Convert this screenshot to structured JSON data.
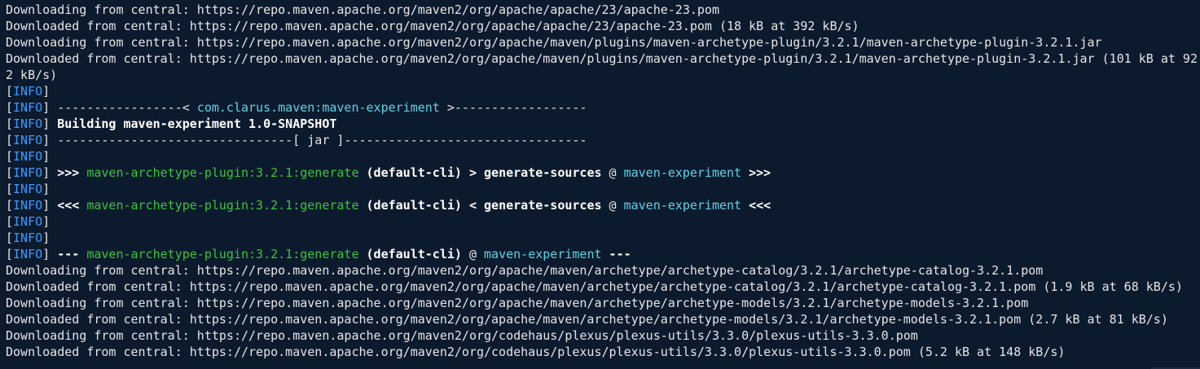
{
  "terminal": {
    "lines": [
      [
        {
          "t": "Downloading from central: https://repo.maven.apache.org/maven2/org/apache/apache/23/apache-23.pom",
          "c": "plain"
        }
      ],
      [
        {
          "t": "Downloaded from central: https://repo.maven.apache.org/maven2/org/apache/apache/23/apache-23.pom (18 kB at 392 kB/s)",
          "c": "plain"
        }
      ],
      [
        {
          "t": "Downloading from central: https://repo.maven.apache.org/maven2/org/apache/maven/plugins/maven-archetype-plugin/3.2.1/maven-archetype-plugin-3.2.1.jar",
          "c": "plain"
        }
      ],
      [
        {
          "t": "Downloaded from central: https://repo.maven.apache.org/maven2/org/apache/maven/plugins/maven-archetype-plugin/3.2.1/maven-archetype-plugin-3.2.1.jar (101 kB at 92",
          "c": "plain"
        }
      ],
      [
        {
          "t": "2 kB/s)",
          "c": "plain"
        }
      ],
      [
        {
          "t": "[",
          "c": "bracket"
        },
        {
          "t": "INFO",
          "c": "info"
        },
        {
          "t": "]",
          "c": "bracket"
        }
      ],
      [
        {
          "t": "[",
          "c": "bracket"
        },
        {
          "t": "INFO",
          "c": "info"
        },
        {
          "t": "] -----------------< ",
          "c": "bracket"
        },
        {
          "t": "com.clarus.maven:maven-experiment",
          "c": "cyan"
        },
        {
          "t": " >------------------",
          "c": "bracket"
        }
      ],
      [
        {
          "t": "[",
          "c": "bracket"
        },
        {
          "t": "INFO",
          "c": "info"
        },
        {
          "t": "] ",
          "c": "bracket"
        },
        {
          "t": "Building maven-experiment 1.0-SNAPSHOT",
          "c": "bold"
        }
      ],
      [
        {
          "t": "[",
          "c": "bracket"
        },
        {
          "t": "INFO",
          "c": "info"
        },
        {
          "t": "] --------------------------------[ jar ]---------------------------------",
          "c": "bracket"
        }
      ],
      [
        {
          "t": "[",
          "c": "bracket"
        },
        {
          "t": "INFO",
          "c": "info"
        },
        {
          "t": "]",
          "c": "bracket"
        }
      ],
      [
        {
          "t": "[",
          "c": "bracket"
        },
        {
          "t": "INFO",
          "c": "info"
        },
        {
          "t": "] ",
          "c": "bracket"
        },
        {
          "t": ">>> ",
          "c": "bold"
        },
        {
          "t": "maven-archetype-plugin:3.2.1:generate",
          "c": "green"
        },
        {
          "t": " (default-cli) > generate-sources",
          "c": "bold"
        },
        {
          "t": " @ ",
          "c": "plain"
        },
        {
          "t": "maven-experiment",
          "c": "cyan"
        },
        {
          "t": " >>>",
          "c": "bold"
        }
      ],
      [
        {
          "t": "[",
          "c": "bracket"
        },
        {
          "t": "INFO",
          "c": "info"
        },
        {
          "t": "]",
          "c": "bracket"
        }
      ],
      [
        {
          "t": "[",
          "c": "bracket"
        },
        {
          "t": "INFO",
          "c": "info"
        },
        {
          "t": "] ",
          "c": "bracket"
        },
        {
          "t": "<<< ",
          "c": "bold"
        },
        {
          "t": "maven-archetype-plugin:3.2.1:generate",
          "c": "green"
        },
        {
          "t": " (default-cli) < generate-sources",
          "c": "bold"
        },
        {
          "t": " @ ",
          "c": "plain"
        },
        {
          "t": "maven-experiment",
          "c": "cyan"
        },
        {
          "t": " <<<",
          "c": "bold"
        }
      ],
      [
        {
          "t": "[",
          "c": "bracket"
        },
        {
          "t": "INFO",
          "c": "info"
        },
        {
          "t": "]",
          "c": "bracket"
        }
      ],
      [
        {
          "t": "[",
          "c": "bracket"
        },
        {
          "t": "INFO",
          "c": "info"
        },
        {
          "t": "]",
          "c": "bracket"
        }
      ],
      [
        {
          "t": "[",
          "c": "bracket"
        },
        {
          "t": "INFO",
          "c": "info"
        },
        {
          "t": "] ",
          "c": "bracket"
        },
        {
          "t": "--- ",
          "c": "bold"
        },
        {
          "t": "maven-archetype-plugin:3.2.1:generate",
          "c": "green"
        },
        {
          "t": " (default-cli)",
          "c": "bold"
        },
        {
          "t": " @ ",
          "c": "plain"
        },
        {
          "t": "maven-experiment",
          "c": "cyan"
        },
        {
          "t": " ---",
          "c": "bold"
        }
      ],
      [
        {
          "t": "Downloading from central: https://repo.maven.apache.org/maven2/org/apache/maven/archetype/archetype-catalog/3.2.1/archetype-catalog-3.2.1.pom",
          "c": "plain"
        }
      ],
      [
        {
          "t": "Downloaded from central: https://repo.maven.apache.org/maven2/org/apache/maven/archetype/archetype-catalog/3.2.1/archetype-catalog-3.2.1.pom (1.9 kB at 68 kB/s)",
          "c": "plain"
        }
      ],
      [
        {
          "t": "Downloading from central: https://repo.maven.apache.org/maven2/org/apache/maven/archetype/archetype-models/3.2.1/archetype-models-3.2.1.pom",
          "c": "plain"
        }
      ],
      [
        {
          "t": "Downloaded from central: https://repo.maven.apache.org/maven2/org/apache/maven/archetype/archetype-models/3.2.1/archetype-models-3.2.1.pom (2.7 kB at 81 kB/s)",
          "c": "plain"
        }
      ],
      [
        {
          "t": "Downloading from central: https://repo.maven.apache.org/maven2/org/codehaus/plexus/plexus-utils/3.3.0/plexus-utils-3.3.0.pom",
          "c": "plain"
        }
      ],
      [
        {
          "t": "Downloaded from central: https://repo.maven.apache.org/maven2/org/codehaus/plexus/plexus-utils/3.3.0/plexus-utils-3.3.0.pom (5.2 kB at 148 kB/s)",
          "c": "plain"
        }
      ]
    ]
  },
  "colors": {
    "background": "#0c1a2e",
    "text": "#e6e6e6",
    "info": "#3b9cff",
    "plugin": "#3cc43c",
    "project": "#5fd4e6"
  }
}
